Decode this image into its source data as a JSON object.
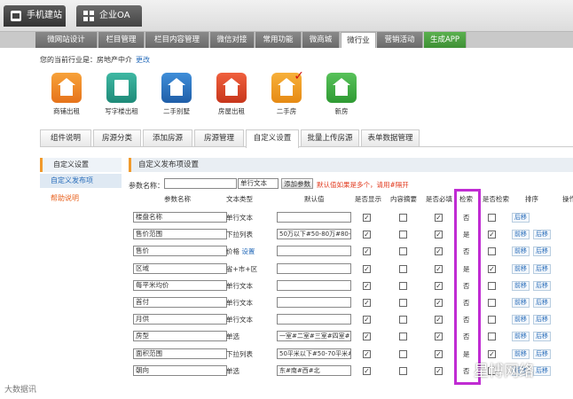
{
  "top_tabs": [
    {
      "label": "手机建站",
      "active": true
    },
    {
      "label": "企业OA",
      "active": false
    }
  ],
  "main_nav": [
    "微网站设计",
    "栏目管理",
    "栏目内容管理",
    "微信对接",
    "常用功能",
    "微商城",
    "微行业",
    "营销活动",
    "生成APP"
  ],
  "main_nav_active": "微行业",
  "industry": {
    "label": "您的当前行业是：房地产中介",
    "change": "更改"
  },
  "app_icons": [
    {
      "label": "商铺出租",
      "icon": "shop-icon"
    },
    {
      "label": "写字楼出租",
      "icon": "office-building-icon"
    },
    {
      "label": "二手别墅",
      "icon": "villa-icon"
    },
    {
      "label": "房屋出租",
      "icon": "house-rent-icon"
    },
    {
      "label": "二手房",
      "icon": "second-hand-house-icon"
    },
    {
      "label": "新房",
      "icon": "new-house-icon"
    }
  ],
  "sub_tabs": [
    "组件说明",
    "房源分类",
    "添加房源",
    "房源管理",
    "自定义设置",
    "批量上传房源",
    "表单数据管理"
  ],
  "sub_tabs_active": "自定义设置",
  "sidebar": [
    "自定义设置",
    "自定义发布项",
    "帮助说明"
  ],
  "content_title": "自定义发布项设置",
  "add_param": {
    "label": "参数名称：",
    "select": "单行文本",
    "button": "添加参数",
    "note": "默认值如果是多个，请用#隔开"
  },
  "columns": [
    "参数名称",
    "文本类型",
    "默认值",
    "是否显示",
    "内容摘要",
    "是否必填",
    "检索",
    "是否检索",
    "排序",
    "操作"
  ],
  "rows": [
    {
      "name": "楼盘名称",
      "type": "单行文本",
      "default": "",
      "show": true,
      "summary": false,
      "required": true,
      "search": "否",
      "searchable": false,
      "actions": [
        "后移"
      ]
    },
    {
      "name": "售价范围",
      "type": "下拉列表",
      "default": "50万以下#50-80万#80-100",
      "show": true,
      "summary": false,
      "required": true,
      "search": "是",
      "searchable": true,
      "actions": [
        "前移",
        "后移"
      ]
    },
    {
      "name": "售价",
      "type": "价格",
      "type_link": "设置",
      "default": "",
      "show": true,
      "summary": false,
      "required": true,
      "search": "否",
      "searchable": false,
      "actions": [
        "前移",
        "后移"
      ]
    },
    {
      "name": "区域",
      "type": "省+市+区",
      "default": "",
      "show": true,
      "summary": false,
      "required": true,
      "search": "是",
      "searchable": true,
      "actions": [
        "前移",
        "后移"
      ]
    },
    {
      "name": "每平米均价",
      "type": "单行文本",
      "default": "",
      "show": true,
      "summary": false,
      "required": true,
      "search": "否",
      "searchable": false,
      "actions": [
        "前移",
        "后移"
      ]
    },
    {
      "name": "首付",
      "type": "单行文本",
      "default": "",
      "show": true,
      "summary": false,
      "required": true,
      "search": "否",
      "searchable": false,
      "actions": [
        "前移",
        "后移"
      ]
    },
    {
      "name": "月供",
      "type": "单行文本",
      "default": "",
      "show": true,
      "summary": false,
      "required": true,
      "search": "否",
      "searchable": false,
      "actions": [
        "前移",
        "后移"
      ]
    },
    {
      "name": "房型",
      "type": "单选",
      "default": "一室#二室#三室#四室#五",
      "show": true,
      "summary": false,
      "required": true,
      "search": "否",
      "searchable": false,
      "actions": [
        "前移",
        "后移"
      ]
    },
    {
      "name": "面积范围",
      "type": "下拉列表",
      "default": "50平米以下#50-70平米#",
      "show": true,
      "summary": false,
      "required": true,
      "search": "是",
      "searchable": true,
      "actions": [
        "前移",
        "后移"
      ]
    },
    {
      "name": "朝向",
      "type": "单选",
      "default": "东#南#西#北",
      "show": true,
      "summary": false,
      "required": true,
      "search": "否",
      "searchable": false,
      "actions": [
        "前移",
        "后移"
      ]
    }
  ],
  "watermark_left": "大数据讯",
  "watermark_right": "星博网络",
  "colors": {
    "highlight_box": "#c02cd3",
    "link": "#2a6ebb",
    "note": "#e23a1e"
  }
}
